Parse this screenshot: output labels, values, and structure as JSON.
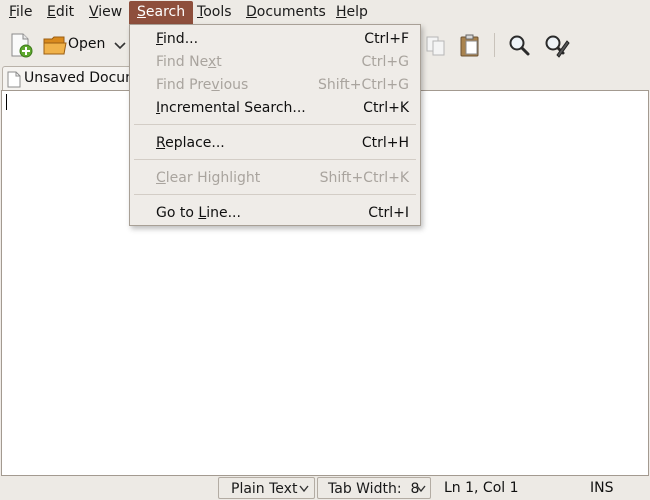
{
  "menubar": {
    "items": [
      {
        "label": "File",
        "mnemonic": "F",
        "rest": "ile"
      },
      {
        "label": "Edit",
        "mnemonic": "E",
        "rest": "dit"
      },
      {
        "label": "View",
        "mnemonic": "V",
        "rest": "iew"
      },
      {
        "label": "Search",
        "mnemonic": "S",
        "rest": "earch"
      },
      {
        "label": "Tools",
        "mnemonic": "T",
        "rest": "ools"
      },
      {
        "label": "Documents",
        "mnemonic": "D",
        "rest": "ocuments"
      },
      {
        "label": "Help",
        "mnemonic": "H",
        "rest": "elp"
      }
    ]
  },
  "toolbar": {
    "open_label": "Open"
  },
  "tab": {
    "label": "Unsaved Docum"
  },
  "search_menu": {
    "items": [
      {
        "pre": "",
        "mn": "F",
        "post": "ind...",
        "accel": "Ctrl+F"
      },
      {
        "pre": "Find Ne",
        "mn": "x",
        "post": "t",
        "accel": "Ctrl+G"
      },
      {
        "pre": "Find Pre",
        "mn": "v",
        "post": "ious",
        "accel": "Shift+Ctrl+G"
      },
      {
        "pre": "",
        "mn": "I",
        "post": "ncremental Search...",
        "accel": "Ctrl+K"
      },
      {
        "pre": "",
        "mn": "R",
        "post": "eplace...",
        "accel": "Ctrl+H"
      },
      {
        "pre": "",
        "mn": "C",
        "post": "lear Highlight",
        "accel": "Shift+Ctrl+K"
      },
      {
        "pre": "Go to ",
        "mn": "L",
        "post": "ine...",
        "accel": "Ctrl+I"
      }
    ]
  },
  "statusbar": {
    "language": "Plain Text",
    "tab_width": "Tab Width:  8",
    "position": "Ln 1, Col 1",
    "mode": "INS"
  },
  "colors": {
    "menu_highlight": "#8e4f3c",
    "disabled_text": "#a9a49e"
  }
}
